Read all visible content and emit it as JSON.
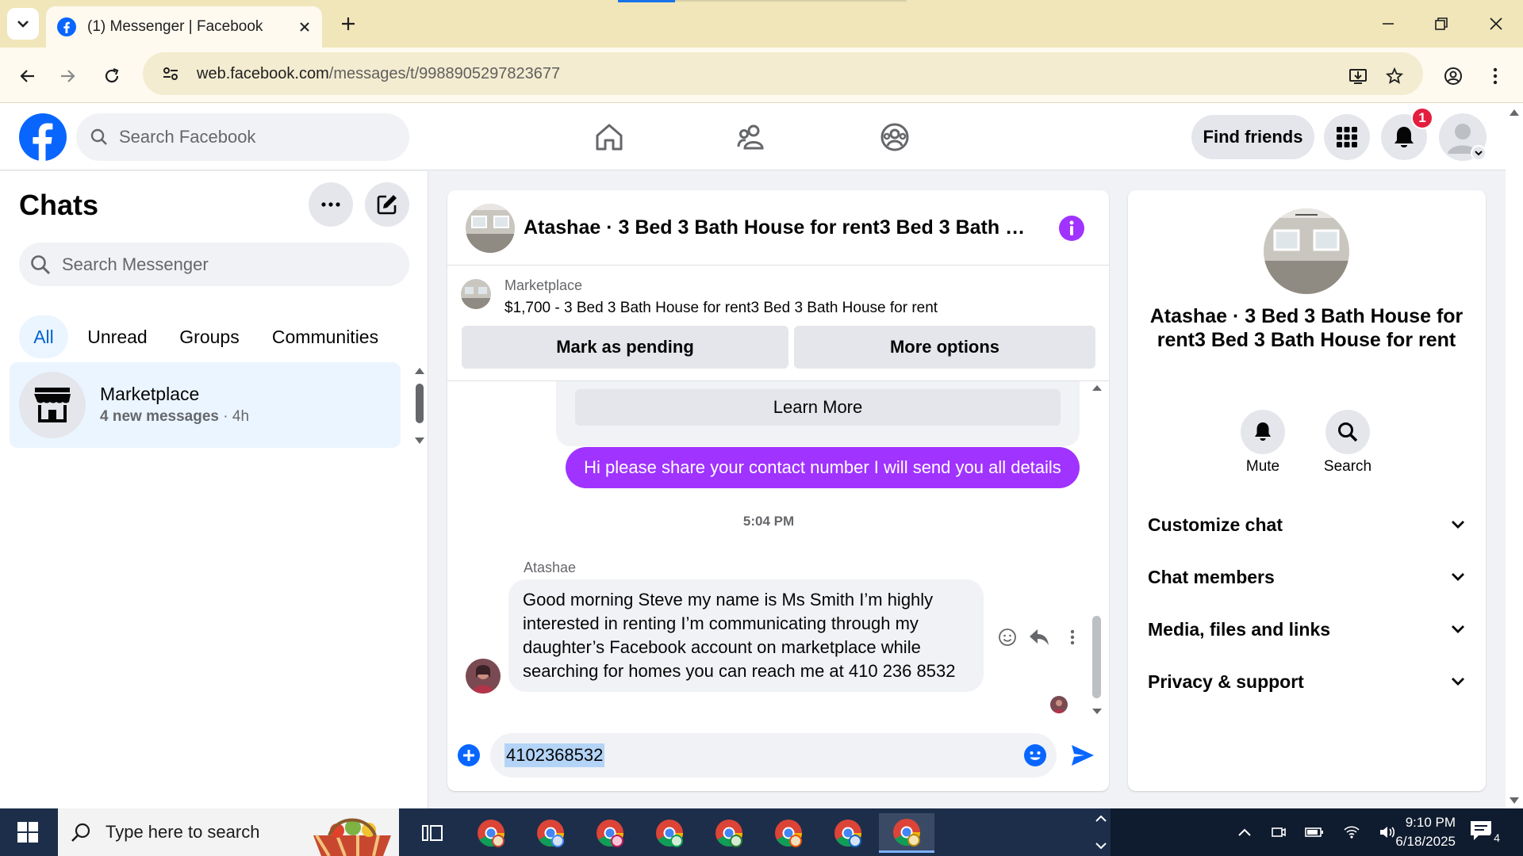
{
  "browser": {
    "tab_title": "(1) Messenger | Facebook",
    "url_host": "web.facebook.com",
    "url_path": "/messages/t/9988905297823677"
  },
  "fb_header": {
    "search_placeholder": "Search Facebook",
    "find_friends_label": "Find friends",
    "notification_count": "1"
  },
  "chats_panel": {
    "title": "Chats",
    "search_placeholder": "Search Messenger",
    "filters": [
      "All",
      "Unread",
      "Groups",
      "Communities"
    ],
    "items": [
      {
        "name": "Marketplace",
        "preview": "4 new messages",
        "time": "· 4h"
      }
    ]
  },
  "conversation": {
    "title": "Atashae · 3 Bed 3 Bath House for rent3 Bed 3 Bath House for rent",
    "marketplace_label": "Marketplace",
    "listing": "$1,700 - 3 Bed 3 Bath House for rent3 Bed 3 Bath House for rent",
    "mark_pending_label": "Mark as pending",
    "more_options_label": "More options",
    "learn_more_label": "Learn More",
    "messages": [
      {
        "from": "me",
        "text": "Hi please share your contact number I will send you all details"
      },
      {
        "from": "Atashae",
        "text": "Good morning Steve my name is Ms Smith I’m  highly interested in renting I’m communicating through my daughter’s Facebook account on marketplace while searching for homes you can reach me at 410 236 8532"
      }
    ],
    "timestamp": "5:04 PM",
    "sender_name": "Atashae",
    "composer_value": "4102368532"
  },
  "details_panel": {
    "name": "Atashae · 3 Bed 3 Bath House for rent3 Bed 3 Bath House for rent",
    "actions": [
      "Mute",
      "Search"
    ],
    "sections": [
      "Customize chat",
      "Chat members",
      "Media, files and links",
      "Privacy & support"
    ]
  },
  "taskbar": {
    "search_placeholder": "Type here to search",
    "time": "9:10 PM",
    "date": "6/18/2025",
    "notification_count": "4"
  },
  "colors": {
    "facebook_blue": "#0866ff",
    "messenger_purple": "#a033ff",
    "browser_frame": "#f0e6ba",
    "taskbar": "#1c2e4a"
  },
  "icons": [
    "home-icon",
    "friends-icon",
    "groups-icon",
    "menu-grid-icon",
    "bell-icon",
    "info-icon",
    "send-icon",
    "emoji-icon",
    "plus-icon",
    "reply-icon"
  ]
}
